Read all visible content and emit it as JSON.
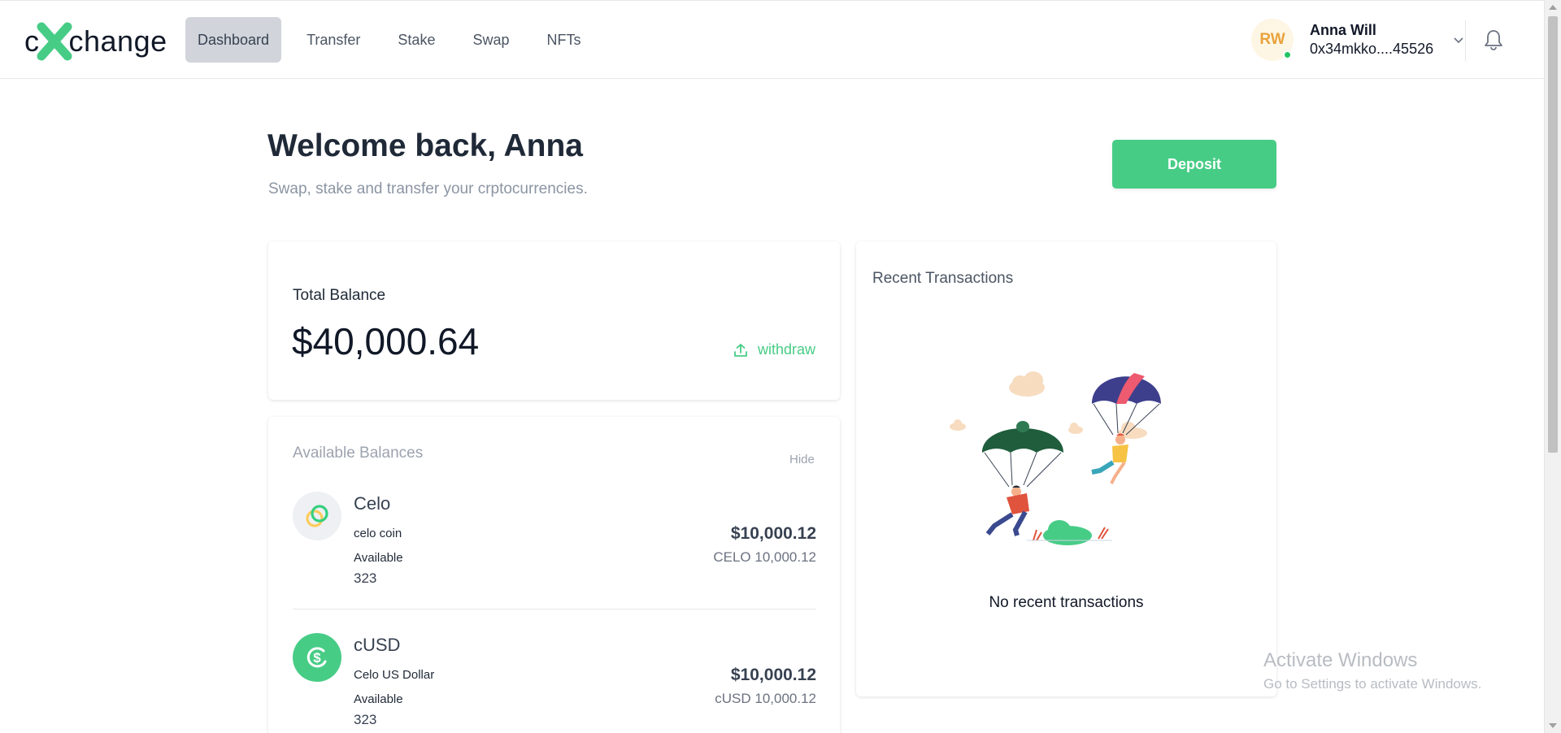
{
  "brand": {
    "logo_left": "c",
    "logo_right": "change",
    "accent": "#47cc86"
  },
  "nav": {
    "items": [
      {
        "label": "Dashboard",
        "active": true
      },
      {
        "label": "Transfer",
        "active": false
      },
      {
        "label": "Stake",
        "active": false
      },
      {
        "label": "Swap",
        "active": false
      },
      {
        "label": "NFTs",
        "active": false
      }
    ]
  },
  "user": {
    "initials": "RW",
    "name": "Anna Will",
    "address": "0x34mkko....45526",
    "status_color": "#22c55e"
  },
  "icons": {
    "chevron": "chevron-down-icon",
    "notifications": "bell-icon",
    "withdraw": "upload-icon"
  },
  "page": {
    "welcome": "Welcome back, Anna",
    "subtitle": "Swap, stake and transfer your crptocurrencies.",
    "deposit_label": "Deposit"
  },
  "total_balance": {
    "label": "Total Balance",
    "value": "$40,000.64",
    "withdraw_label": "withdraw"
  },
  "balances": {
    "title": "Available Balances",
    "hide_label": "Hide",
    "assets": [
      {
        "name": "Celo",
        "subtitle": "celo coin",
        "available_label": "Available",
        "available": "323",
        "usd": "$10,000.12",
        "native": "CELO 10,000.12",
        "icon": "celo-icon"
      },
      {
        "name": "cUSD",
        "subtitle": "Celo US Dollar",
        "available_label": "Available",
        "available": "323",
        "usd": "$10,000.12",
        "native": "cUSD 10,000.12",
        "icon": "cusd-icon"
      }
    ]
  },
  "recent": {
    "title": "Recent Transactions",
    "empty": "No recent transactions"
  },
  "watermark": {
    "title": "Activate Windows",
    "subtitle": "Go to Settings to activate Windows."
  }
}
